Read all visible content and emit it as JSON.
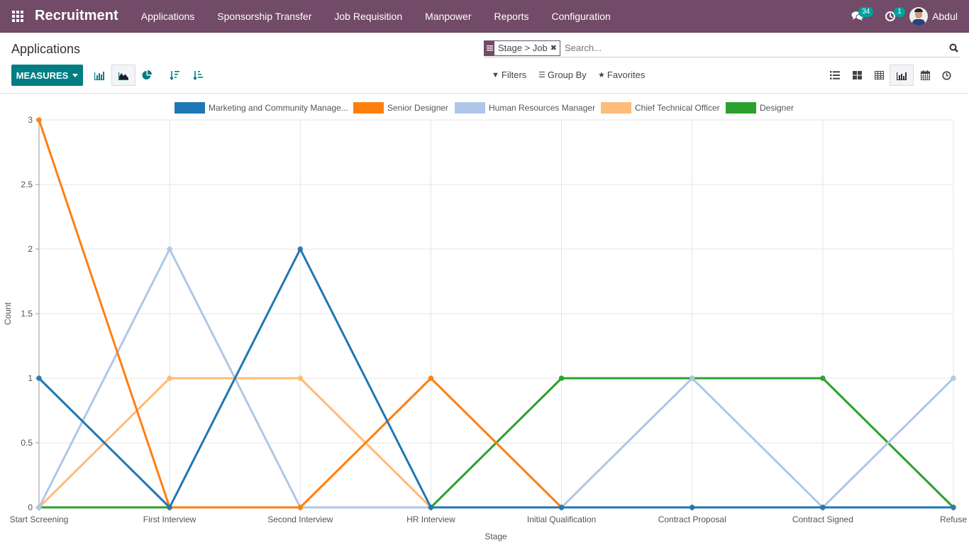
{
  "navbar": {
    "app_name": "Recruitment",
    "menu": [
      "Applications",
      "Sponsorship Transfer",
      "Job Requisition",
      "Manpower",
      "Reports",
      "Configuration"
    ],
    "messages_count": "34",
    "activities_count": "1",
    "user_name": "Abdul"
  },
  "control_panel": {
    "title": "Applications",
    "measures_label": "MEASURES",
    "search": {
      "facet": "Stage > Job",
      "placeholder": "Search..."
    },
    "filters_label": "Filters",
    "groupby_label": "Group By",
    "favorites_label": "Favorites",
    "graph_modes": [
      "bar-chart",
      "line-chart",
      "pie-chart"
    ],
    "active_graph_mode": "line-chart",
    "views": [
      "list",
      "kanban",
      "pivot",
      "graph",
      "calendar",
      "activity"
    ],
    "active_view": "graph"
  },
  "colors": {
    "brand": "#714b67",
    "accent": "#017e84",
    "badge": "#00a09d"
  },
  "chart_data": {
    "type": "line",
    "title": "",
    "xlabel": "Stage",
    "ylabel": "Count",
    "ylim": [
      0,
      3
    ],
    "yticks": [
      "0",
      "0.5",
      "1",
      "1.5",
      "2",
      "2.5",
      "3"
    ],
    "grid": true,
    "legend_position": "top-center",
    "categories": [
      "Start Screening",
      "First Interview",
      "Second Interview",
      "HR Interview",
      "Initial Qualification",
      "Contract Proposal",
      "Contract Signed",
      "Refuse"
    ],
    "series": [
      {
        "name": "Marketing and Community Manage...",
        "color": "#1f77b4",
        "values": [
          1,
          0,
          2,
          0,
          0,
          0,
          0,
          0
        ]
      },
      {
        "name": "Senior Designer",
        "color": "#ff7f0e",
        "values": [
          3,
          0,
          0,
          1,
          0,
          0,
          0,
          0
        ]
      },
      {
        "name": "Human Resources Manager",
        "color": "#aec7e8",
        "values": [
          0,
          2,
          0,
          0,
          0,
          1,
          0,
          1
        ]
      },
      {
        "name": "Chief Technical Officer",
        "color": "#ffbb78",
        "values": [
          0,
          1,
          1,
          0,
          0,
          0,
          0,
          0
        ]
      },
      {
        "name": "Designer",
        "color": "#2ca02c",
        "values": [
          0,
          0,
          0,
          0,
          1,
          1,
          1,
          0
        ]
      }
    ]
  }
}
